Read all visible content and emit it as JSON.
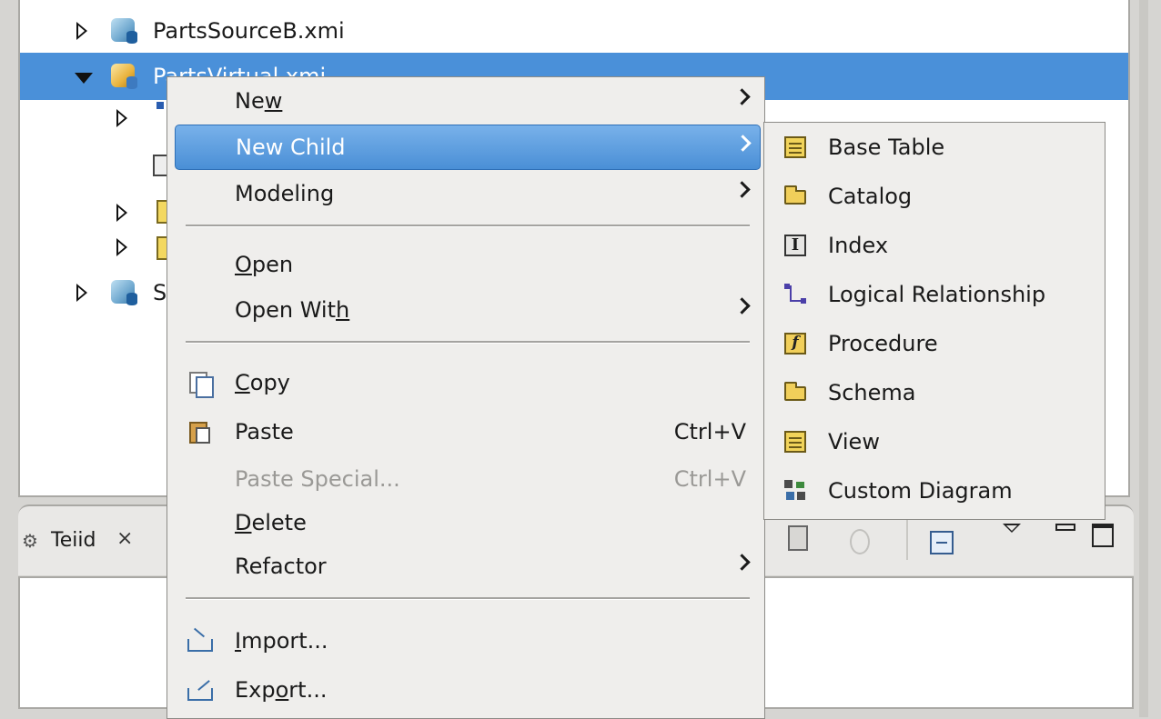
{
  "tree": {
    "items": [
      {
        "label": "PartsSourceB.xmi"
      },
      {
        "label": "PartsVirtual.xmi"
      },
      {
        "label": "S"
      }
    ]
  },
  "teiid_view": {
    "tab_label": "Teiid",
    "close_glyph": "⨯"
  },
  "context_menu": {
    "new": {
      "before": "Ne",
      "underline": "w",
      "after": ""
    },
    "new_child": "New Child",
    "modeling": "Modeling",
    "open": {
      "underline": "O",
      "after": "pen"
    },
    "open_with": {
      "before": "Open Wit",
      "underline": "h",
      "after": ""
    },
    "copy": {
      "underline": "C",
      "after": "opy"
    },
    "paste": "Paste",
    "paste_accel": "Ctrl+V",
    "paste_special": "Paste Special...",
    "paste_special_accel": "Ctrl+V",
    "delete": {
      "underline": "D",
      "after": "elete"
    },
    "refactor": "Refactor",
    "import": {
      "underline": "I",
      "after": "mport..."
    },
    "export": {
      "before": "Exp",
      "underline": "o",
      "after": "rt..."
    }
  },
  "submenu": {
    "items": [
      {
        "label": "Base Table",
        "icon": "table-icon"
      },
      {
        "label": "Catalog",
        "icon": "folder-icon"
      },
      {
        "label": "Index",
        "icon": "index-icon"
      },
      {
        "label": "Logical Relationship",
        "icon": "relationship-icon"
      },
      {
        "label": "Procedure",
        "icon": "procedure-icon"
      },
      {
        "label": "Schema",
        "icon": "folder-icon"
      },
      {
        "label": "View",
        "icon": "table-icon"
      },
      {
        "label": "Custom Diagram",
        "icon": "diagram-icon"
      }
    ]
  },
  "colors": {
    "selection": "#4a90d9",
    "menu_highlight": "#5a9be0",
    "menu_background": "#efeeec"
  }
}
